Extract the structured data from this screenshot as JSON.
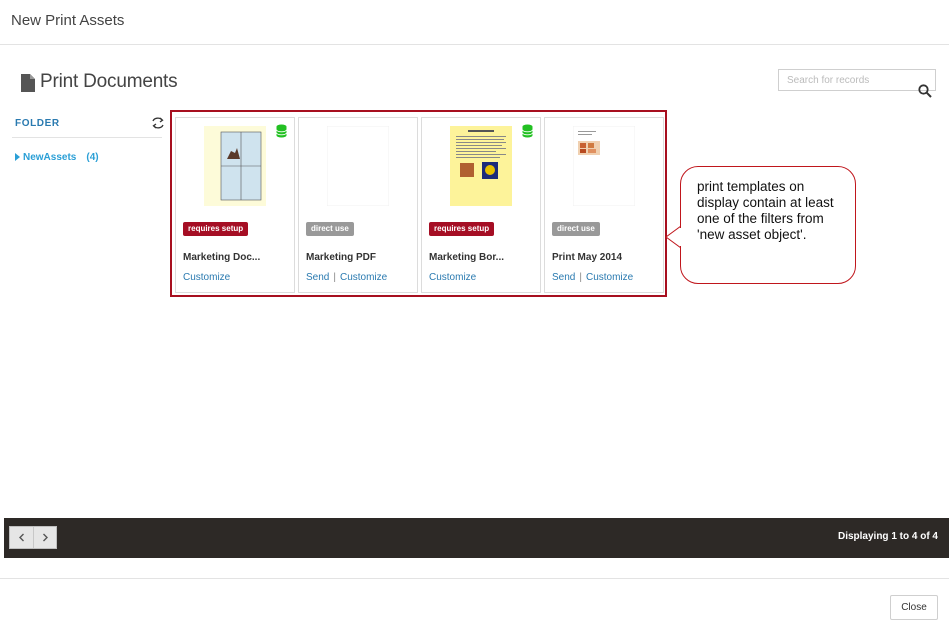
{
  "header": {
    "title": "New Print Assets"
  },
  "page": {
    "title": "Print Documents",
    "icon": "document-icon"
  },
  "search": {
    "placeholder": "Search for records",
    "value": "",
    "icon": "search-icon"
  },
  "sidebar": {
    "folder_label": "FOLDER",
    "refresh_icon": "refresh-icon",
    "items": [
      {
        "label": "NewAssets",
        "count": "(4)"
      }
    ]
  },
  "cards": [
    {
      "badge": "requires setup",
      "badge_type": "setup",
      "title": "Marketing Doc...",
      "actions": [
        "Customize"
      ],
      "has_db_icon": true
    },
    {
      "badge": "direct use",
      "badge_type": "direct",
      "title": "Marketing PDF",
      "actions": [
        "Send",
        "Customize"
      ],
      "has_db_icon": false
    },
    {
      "badge": "requires setup",
      "badge_type": "setup",
      "title": "Marketing Bor...",
      "actions": [
        "Customize"
      ],
      "has_db_icon": true
    },
    {
      "badge": "direct use",
      "badge_type": "direct",
      "title": "Print May 2014",
      "actions": [
        "Send",
        "Customize"
      ],
      "has_db_icon": false
    }
  ],
  "callout": {
    "text": "print templates on display contain at least one of the filters from 'new asset object'."
  },
  "footer": {
    "display_text": "Displaying 1 to 4 of 4",
    "close_label": "Close"
  },
  "colors": {
    "accent": "#2a7ab0",
    "badge_setup": "#a50e24",
    "badge_direct": "#999999",
    "highlight": "#a70f1f",
    "footer_bg": "#2d2926",
    "db_icon": "#22c022"
  }
}
